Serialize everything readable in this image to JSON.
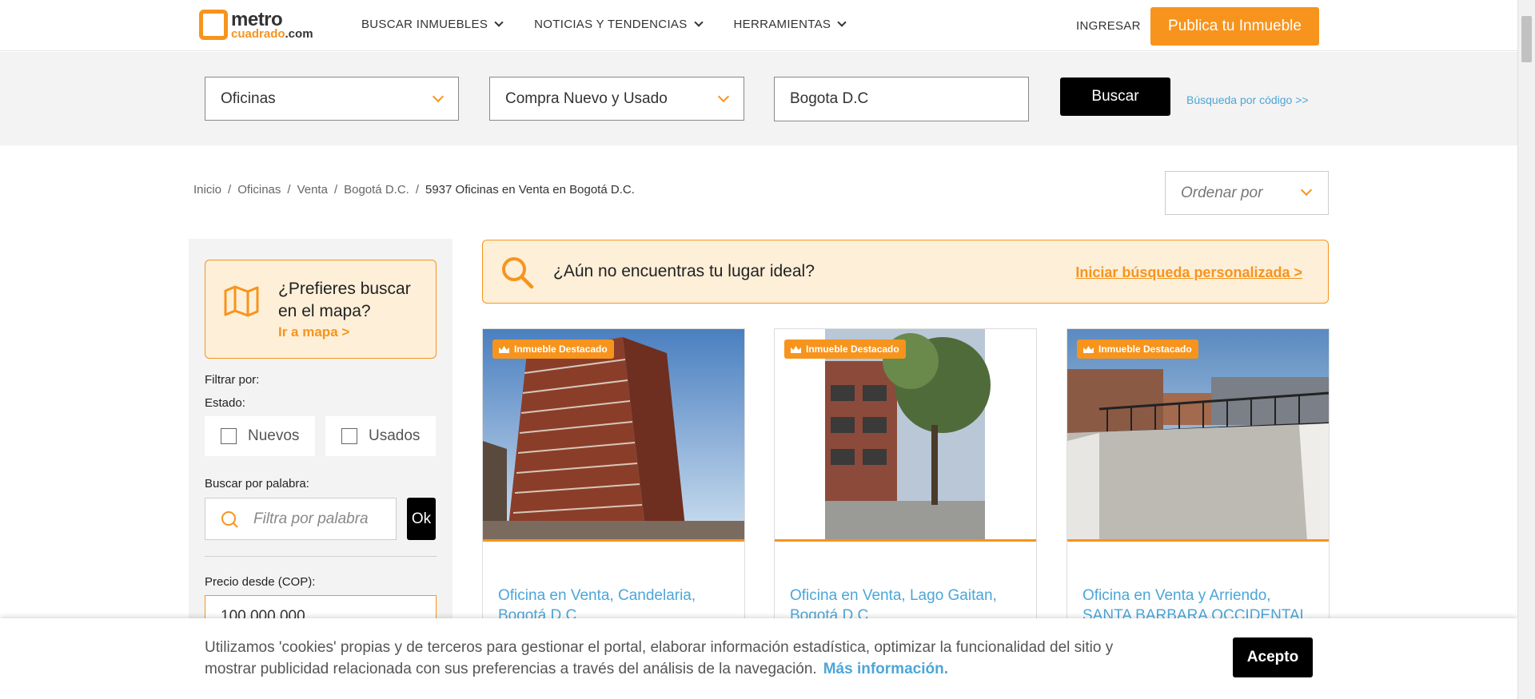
{
  "header": {
    "logo_metro": "metro",
    "logo_cuadrado": "cuadrado",
    "logo_com": ".com",
    "nav": [
      {
        "label": "BUSCAR INMUEBLES"
      },
      {
        "label": "NOTICIAS Y TENDENCIAS"
      },
      {
        "label": "HERRAMIENTAS"
      }
    ],
    "login": "INGRESAR",
    "publish": "Publica tu Inmueble"
  },
  "search": {
    "property_type": "Oficinas",
    "operation": "Compra Nuevo y Usado",
    "location": "Bogota D.C",
    "button": "Buscar",
    "code_link": "Búsqueda por código >>"
  },
  "breadcrumb": {
    "items": [
      "Inicio",
      "Oficinas",
      "Venta",
      "Bogotá D.C."
    ],
    "current": "5937 Oficinas en Venta en Bogotá D.C."
  },
  "order": {
    "placeholder": "Ordenar por"
  },
  "sidebar": {
    "map_title": "¿Prefieres buscar en el mapa?",
    "map_link": "Ir a mapa >",
    "filter_by": "Filtrar por:",
    "state_label": "Estado:",
    "state_new": "Nuevos",
    "state_used": "Usados",
    "word_label": "Buscar por palabra:",
    "word_placeholder": "Filtra por palabra",
    "ok": "Ok",
    "price_label": "Precio desde (COP):",
    "price_value": "100.000.000"
  },
  "banner": {
    "text": "¿Aún no encuentras tu lugar ideal?",
    "link": "Iniciar búsqueda personalizada >"
  },
  "listings": [
    {
      "badge": "Inmueble Destacado",
      "title": "Oficina en Venta, Candelaria, Bogotá D.C"
    },
    {
      "badge": "Inmueble Destacado",
      "title": "Oficina en Venta, Lago Gaitan, Bogotá D.C"
    },
    {
      "badge": "Inmueble Destacado",
      "title": "Oficina en Venta y Arriendo, SANTA BARBARA OCCIDENTAL,"
    }
  ],
  "cookie": {
    "text": "Utilizamos 'cookies' propias y de terceros para gestionar el portal, elaborar información estadística, optimizar la funcionalidad del sitio y mostrar publicidad relacionada con sus preferencias a través del análisis de la navegación.",
    "more": "Más información.",
    "accept": "Acepto"
  },
  "colors": {
    "accent": "#f7941d",
    "link": "#4ca6d8",
    "dark": "#000000"
  }
}
